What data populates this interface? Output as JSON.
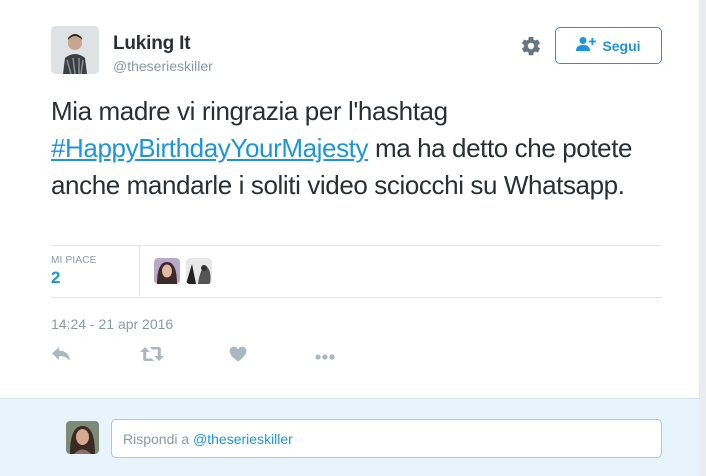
{
  "user": {
    "name": "Luking It",
    "handle": "@theserieskiller"
  },
  "follow_button": {
    "label": "Segui"
  },
  "tweet": {
    "text_before": "Mia madre vi ringrazia per l'hashtag",
    "hashtag": "#HappyBirthdayYourMajesty",
    "text_after": "ma ha detto che potete anche mandarle i soliti video sciocchi su Whatsapp."
  },
  "stats": {
    "likes_label": "MI PIACE",
    "likes_count": "2"
  },
  "timestamp": "14:24 - 21 apr 2016",
  "reply": {
    "prefix": "Rispondi a",
    "mention": "@theserieskiller"
  },
  "colors": {
    "accent": "#1b95e0",
    "text": "#292f33",
    "muted": "#8899a6",
    "reply_bg": "#e8f4fb"
  },
  "icons": [
    "gear-icon",
    "add-user-icon",
    "reply-icon",
    "retweet-icon",
    "heart-icon",
    "more-icon"
  ]
}
